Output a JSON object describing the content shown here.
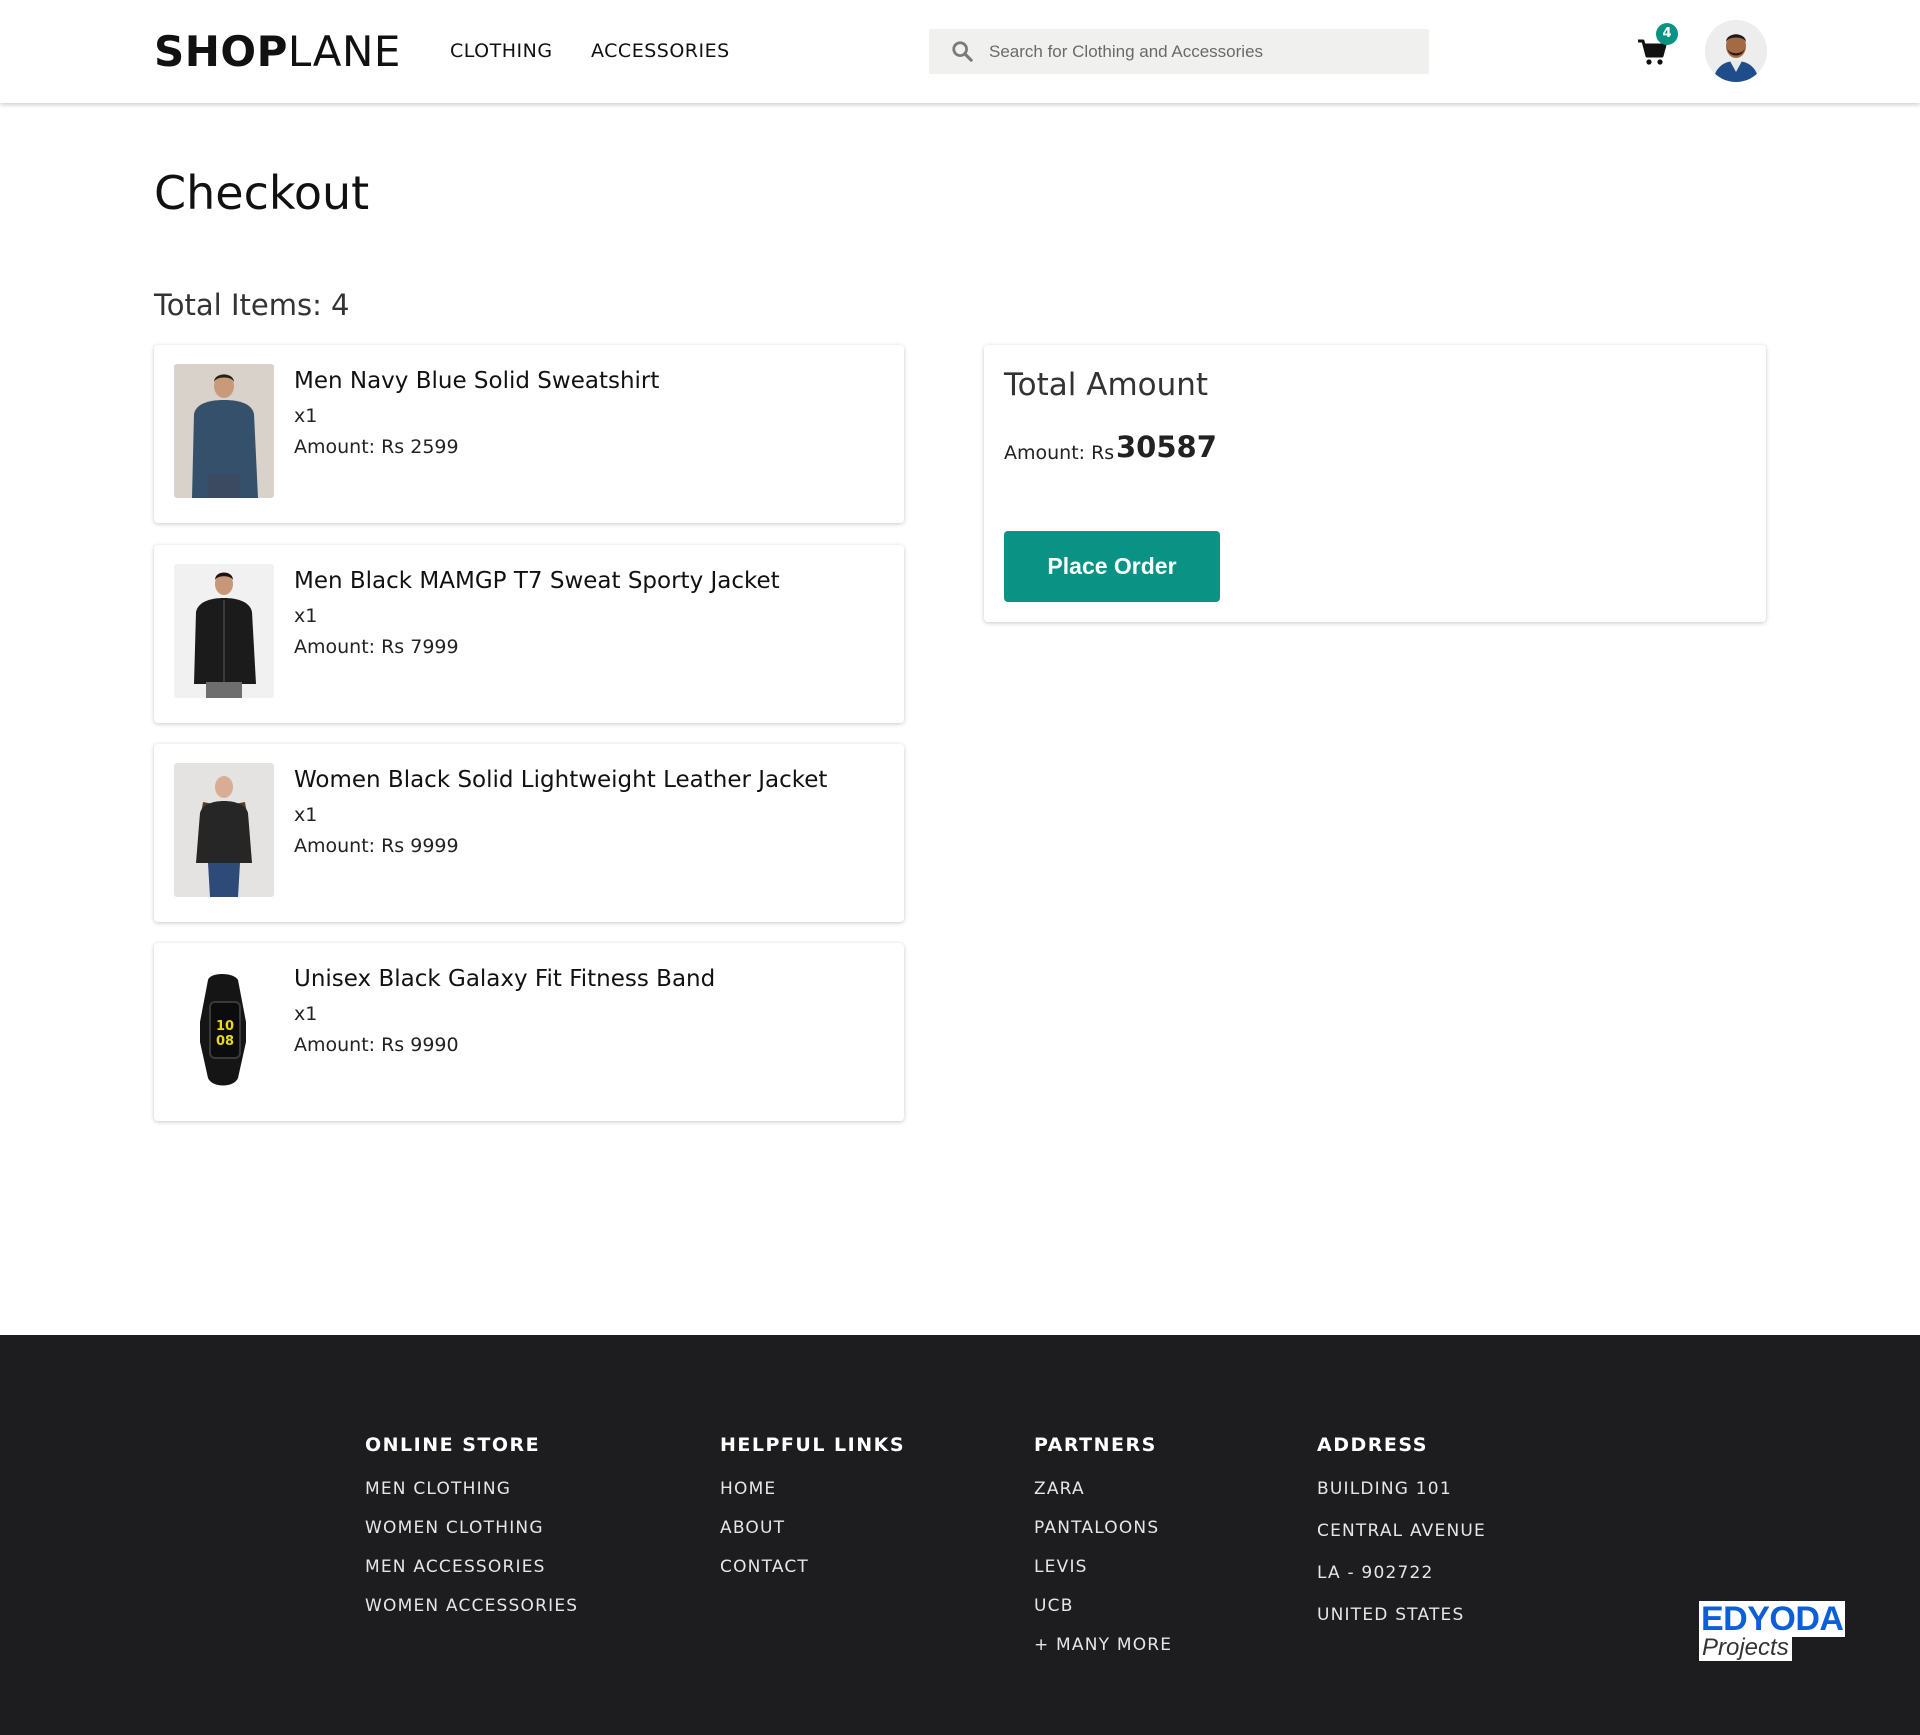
{
  "header": {
    "logo_bold": "SHOP",
    "logo_light": "LANE",
    "nav": [
      {
        "label": "CLOTHING"
      },
      {
        "label": "ACCESSORIES"
      }
    ],
    "search_placeholder": "Search for Clothing and Accessories",
    "cart_count": "4",
    "icons": {
      "search": "search-icon",
      "cart": "cart-icon",
      "avatar": "user-avatar"
    }
  },
  "main": {
    "title": "Checkout",
    "total_items_label": "Total Items: 4",
    "items": [
      {
        "name": "Men Navy Blue Solid Sweatshirt",
        "qty": "x1",
        "amount": "Amount: Rs 2599"
      },
      {
        "name": "Men Black MAMGP T7 Sweat Sporty Jacket",
        "qty": "x1",
        "amount": "Amount: Rs 7999"
      },
      {
        "name": "Women Black Solid Lightweight Leather Jacket",
        "qty": "x1",
        "amount": "Amount: Rs 9999"
      },
      {
        "name": "Unisex Black Galaxy Fit Fitness Band",
        "qty": "x1",
        "amount": "Amount: Rs 9990"
      }
    ]
  },
  "summary": {
    "title": "Total Amount",
    "amount_label": "Amount: Rs",
    "amount_value": "30587",
    "place_order_label": "Place Order"
  },
  "footer": {
    "columns": [
      {
        "heading": "ONLINE STORE",
        "links": [
          "MEN CLOTHING",
          "WOMEN CLOTHING",
          "MEN ACCESSORIES",
          "WOMEN ACCESSORIES"
        ]
      },
      {
        "heading": "HELPFUL LINKS",
        "links": [
          "HOME",
          "ABOUT",
          "CONTACT"
        ]
      },
      {
        "heading": "PARTNERS",
        "links": [
          "ZARA",
          "PANTALOONS",
          "LEVIS",
          "UCB",
          "+ MANY MORE"
        ]
      },
      {
        "heading": "ADDRESS",
        "links": [
          "BUILDING 101",
          "CENTRAL AVENUE",
          "LA - 902722",
          "UNITED STATES"
        ]
      }
    ],
    "badge_top": "EDYODA",
    "badge_bottom": "Projects"
  },
  "colors": {
    "accent": "#0a9385",
    "footer_bg": "#1d1d1f",
    "badge_blue": "#0d5fd8"
  }
}
